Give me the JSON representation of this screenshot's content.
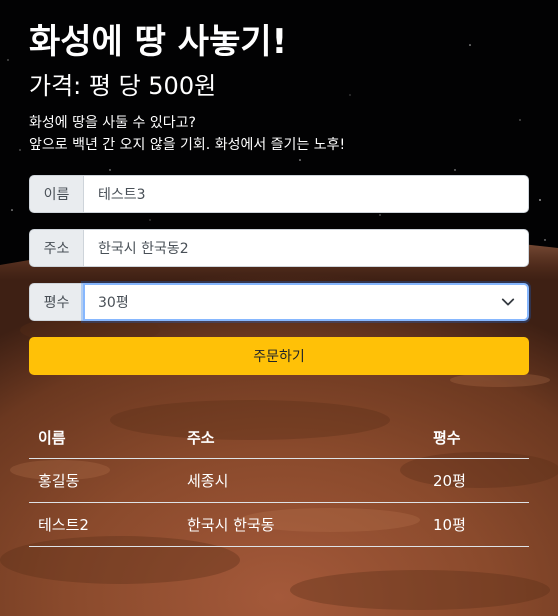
{
  "header": {
    "title": "화성에 땅 사놓기!",
    "price": "가격: 평 당 500원",
    "desc_line1": "화성에 땅을 사둘 수 있다고?",
    "desc_line2": "앞으로 백년 간 오지 않을 기회. 화성에서 즐기는 노후!"
  },
  "form": {
    "name_label": "이름",
    "name_value": "테스트3",
    "address_label": "주소",
    "address_value": "한국시 한국동2",
    "size_label": "평수",
    "size_value": "30평",
    "order_button": "주문하기"
  },
  "table": {
    "headers": [
      "이름",
      "주소",
      "평수"
    ],
    "rows": [
      [
        "홍길동",
        "세종시",
        "20평"
      ],
      [
        "테스트2",
        "한국시 한국동",
        "10평"
      ]
    ]
  },
  "colors": {
    "order_button": "#ffc107",
    "focus_border": "#86b7fe"
  }
}
